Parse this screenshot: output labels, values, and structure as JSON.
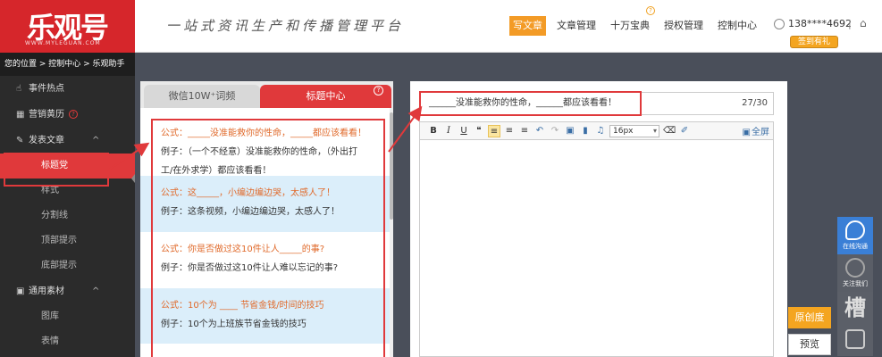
{
  "header": {
    "logo_text": "乐观号",
    "logo_sub": "WWW.MYLEGUAN.COM",
    "slogan": "一站式资讯生产和传播管理平台",
    "nav": [
      {
        "label": "写文章",
        "active": true
      },
      {
        "label": "文章管理",
        "active": false
      },
      {
        "label": "十万宝典",
        "active": false,
        "help": "?"
      },
      {
        "label": "授权管理",
        "active": false
      },
      {
        "label": "控制中心",
        "active": false
      }
    ],
    "user_phone": "138****4692",
    "separator": "|",
    "checkin_label": "签到有礼"
  },
  "sidebar": {
    "breadcrumb": "您的位置 > 控制中心 > 乐观助手",
    "items": [
      {
        "label": "事件热点",
        "icon": "hand-pointer-icon"
      },
      {
        "label": "营销黄历",
        "icon": "calendar-icon",
        "help": "?"
      },
      {
        "label": "发表文章",
        "icon": "edit-icon",
        "chevron": "^"
      }
    ],
    "publish_sub": [
      {
        "label": "标题党",
        "active": true
      },
      {
        "label": "样式"
      },
      {
        "label": "分割线"
      },
      {
        "label": "顶部提示"
      },
      {
        "label": "底部提示"
      }
    ],
    "material": {
      "label": "通用素材",
      "icon": "image-icon",
      "chevron": "^"
    },
    "material_sub": [
      {
        "label": "图库"
      },
      {
        "label": "表情"
      }
    ]
  },
  "left_panel": {
    "tabs": [
      {
        "label": "微信10W⁺词频"
      },
      {
        "label": "标题中心",
        "help": "?"
      }
    ],
    "formulas": [
      {
        "formula": "公式：_____没准能救你的性命，_____都应该看看！",
        "example_lines": [
          "例子：（一个不经意）没准能救你的性命，（外出打",
          "工/在外求学）都应该看看！"
        ]
      },
      {
        "formula": "公式：这_____，小编边编边哭，太感人了！",
        "example_lines": [
          "例子：这条视频，小编边编边哭，太感人了！"
        ]
      },
      {
        "formula": "公式：你是否做过这10件让人_____的事?",
        "example_lines": [
          "例子：你是否做过这10件让人难以忘记的事?"
        ]
      },
      {
        "formula": "公式：10个为 ____ 节省金钱/时间的技巧",
        "example_lines": [
          "例子：10个为上班族节省金钱的技巧"
        ]
      }
    ]
  },
  "editor": {
    "title_value": "______没准能救你的性命，______都应该看看！",
    "title_count": "27/30",
    "toolbar": {
      "bold": "B",
      "italic": "I",
      "underline": "U",
      "quote": "❝",
      "font_size": "16px",
      "fullscreen_label": "全屏"
    }
  },
  "side_actions": {
    "originality": "原创度",
    "preview": "预览"
  },
  "float_bar": {
    "chat_label": "在线沟通",
    "follow_label": "关注我们",
    "slot_glyph": "槽"
  },
  "colors": {
    "brand_red": "#d6262b",
    "accent_orange": "#f39b26",
    "formula_orange": "#e06a2b",
    "row_alt_blue": "#dbeefa",
    "chat_blue": "#3a7fd6"
  }
}
